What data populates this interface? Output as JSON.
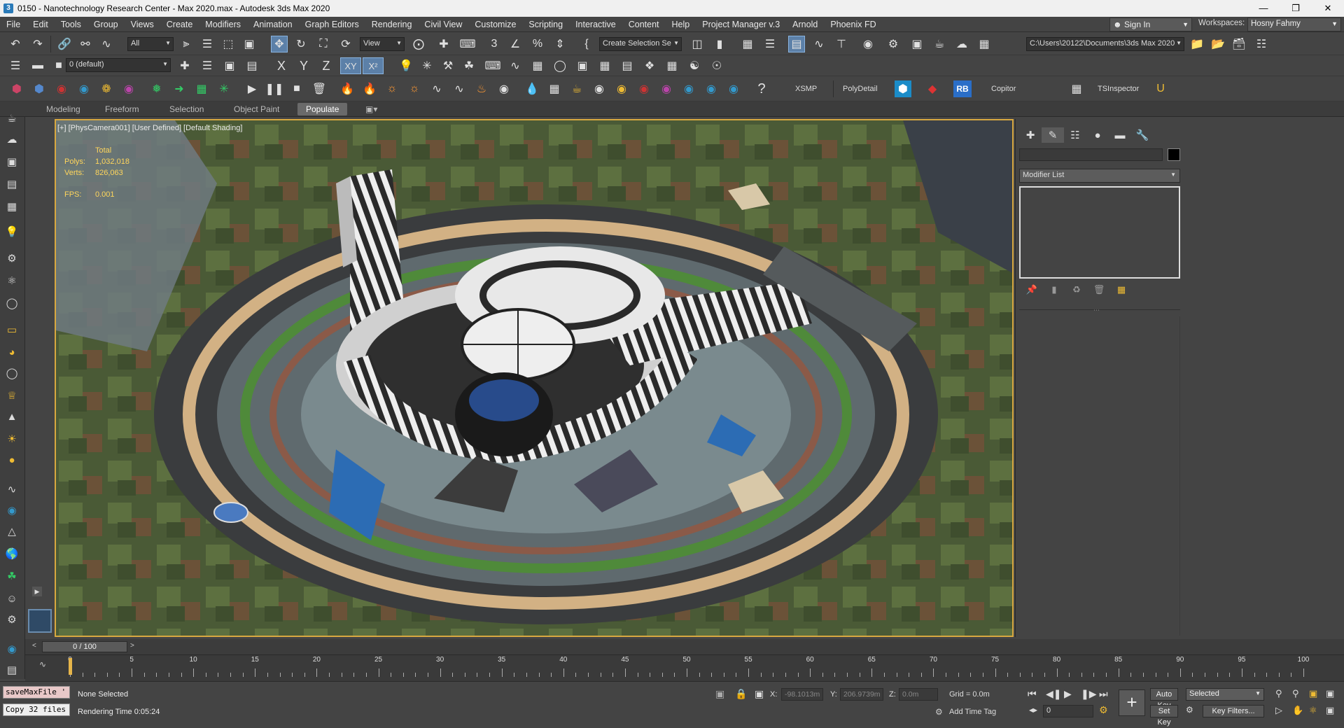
{
  "titlebar": {
    "title": "0150 - Nanotechnology Research Center - Max 2020.max - Autodesk 3ds Max 2020",
    "app_icon": "3"
  },
  "menubar": {
    "items": [
      "File",
      "Edit",
      "Tools",
      "Group",
      "Views",
      "Create",
      "Modifiers",
      "Animation",
      "Graph Editors",
      "Rendering",
      "Civil View",
      "Customize",
      "Scripting",
      "Interactive",
      "Content",
      "Help",
      "Project Manager v.3",
      "Arnold",
      "Phoenix FD"
    ],
    "signin": "Sign In",
    "workspaces_label": "Workspaces:",
    "workspace": "Hosny Fahmy"
  },
  "toolbar1": {
    "selection_filter": "All",
    "ref_coord": "View",
    "named_selection": "Create Selection Se",
    "project_path": "C:\\Users\\20122\\Documents\\3ds Max 2020"
  },
  "toolbar2": {
    "layer": "0 (default)",
    "axis_x": "X",
    "axis_y": "Y",
    "axis_z": "Z",
    "axis_xy": "XY",
    "axis_xy2": "X²"
  },
  "toolbar3": {
    "plugins": [
      "XSMP",
      "PolyDetail",
      "RB",
      "Copitor",
      "TSInspector"
    ]
  },
  "ribbon": {
    "tabs": [
      "Modeling",
      "Freeform",
      "Selection",
      "Object Paint",
      "Populate"
    ],
    "active": "Populate"
  },
  "viewport": {
    "label": "[+] [PhysCamera001] [User Defined] [Default Shading]",
    "stats_header": "Total",
    "polys_label": "Polys:",
    "polys_value": "1,032,018",
    "verts_label": "Verts:",
    "verts_value": "826,063",
    "fps_label": "FPS:",
    "fps_value": "0.001"
  },
  "command_panel": {
    "modifier_list": "Modifier List"
  },
  "timeline": {
    "frame": "0 / 100",
    "left_arrow": "<",
    "right_arrow": ">",
    "labels": [
      "0",
      "5",
      "10",
      "15",
      "20",
      "25",
      "30",
      "35",
      "40",
      "45",
      "50",
      "55",
      "60",
      "65",
      "70",
      "75",
      "80",
      "85",
      "90",
      "95",
      "100"
    ]
  },
  "status": {
    "maxscript_line1": "saveMaxFile '",
    "maxscript_line2": "Copy 32 files",
    "selection": "None Selected",
    "render_time": "Rendering Time  0:05:24",
    "x_label": "X:",
    "x_value": "-98.1013m",
    "y_label": "Y:",
    "y_value": "206.9739m",
    "z_label": "Z:",
    "z_value": "0.0m",
    "grid": "Grid = 0.0m",
    "add_time_tag": "Add Time Tag",
    "auto_key": "Auto Key",
    "set_key": "Set Key",
    "selected": "Selected",
    "key_filters": "Key Filters...",
    "frame_field": "0"
  },
  "colors": {
    "accent": "#5c80a8",
    "viewport_border": "#d8a840",
    "stats_text": "#ffd65c"
  }
}
